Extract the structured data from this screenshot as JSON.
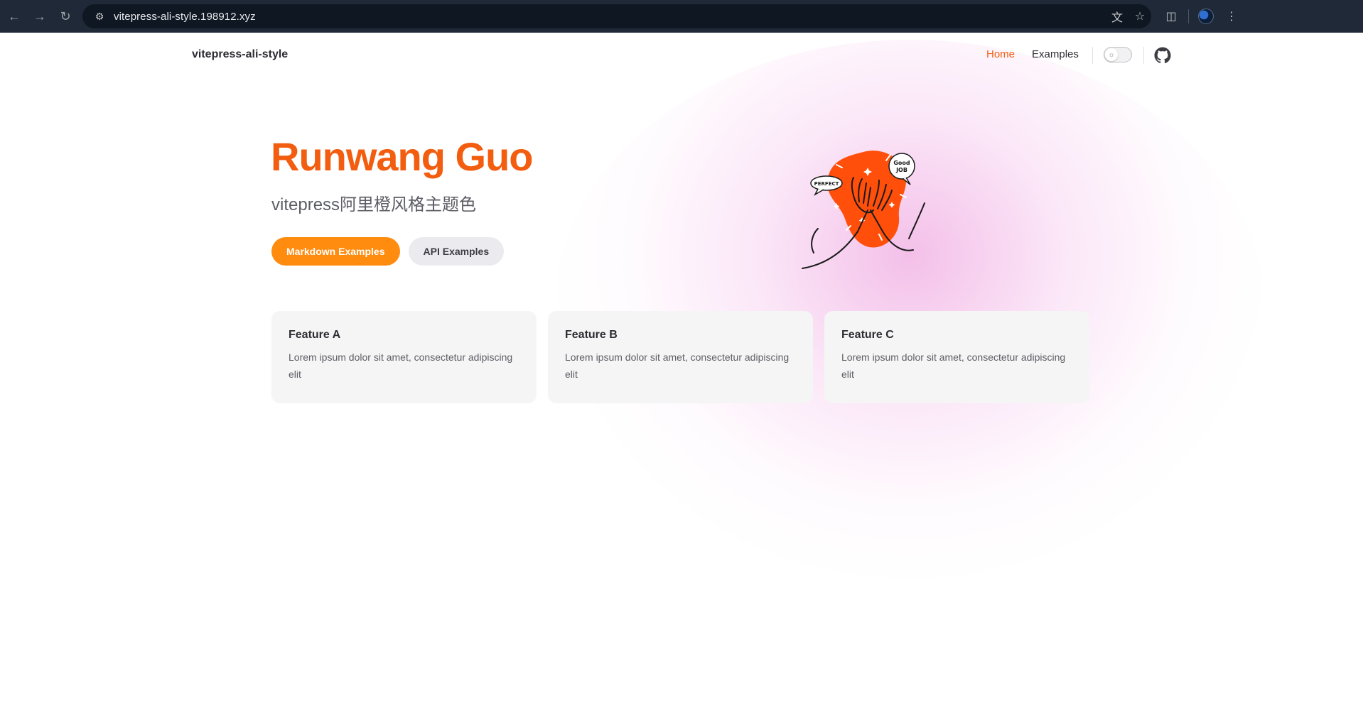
{
  "browser": {
    "url": "vitepress-ali-style.198912.xyz",
    "icons": [
      "back-icon",
      "forward-icon",
      "reload-icon",
      "site-settings-icon",
      "translate-icon",
      "bookmark-star-icon",
      "extensions-icon",
      "profile-avatar",
      "menu-kebab-icon"
    ]
  },
  "navbar": {
    "brand": "vitepress-ali-style",
    "links": [
      {
        "label": "Home",
        "active": true
      },
      {
        "label": "Examples",
        "active": false
      }
    ],
    "accent_color": "#f25d0f"
  },
  "hero": {
    "name": "Runwang Guo",
    "text": "vitepress阿里橙风格主题色",
    "actions": [
      {
        "label": "Markdown Examples",
        "theme": "brand",
        "color": "#ff8b0f"
      },
      {
        "label": "API Examples",
        "theme": "alt"
      }
    ],
    "image": {
      "description_icon": "high-five-illustration",
      "bubble_left": "PERFECT",
      "bubble_right_line1": "Good",
      "bubble_right_line2": "JOB"
    }
  },
  "features": [
    {
      "title": "Feature A",
      "details": "Lorem ipsum dolor sit amet, consectetur adipiscing elit"
    },
    {
      "title": "Feature B",
      "details": "Lorem ipsum dolor sit amet, consectetur adipiscing elit"
    },
    {
      "title": "Feature C",
      "details": "Lorem ipsum dolor sit amet, consectetur adipiscing elit"
    }
  ]
}
